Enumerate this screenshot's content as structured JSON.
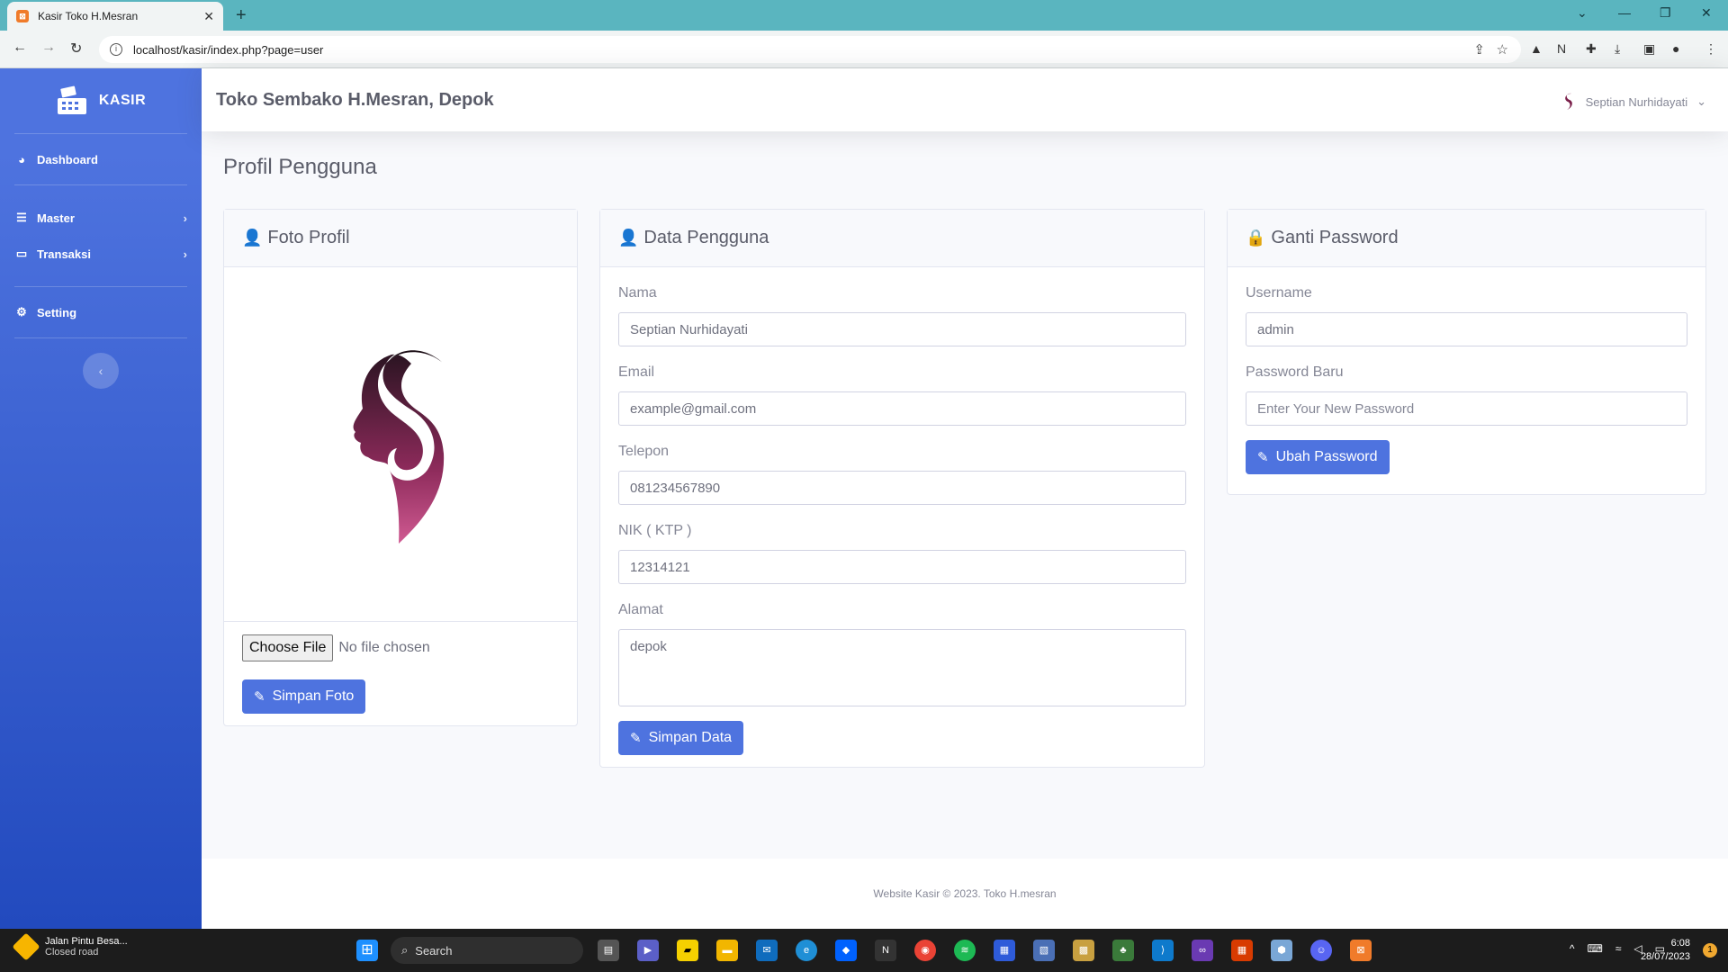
{
  "browser": {
    "tab_title": "Kasir Toko H.Mesran",
    "url": "localhost/kasir/index.php?page=user"
  },
  "sidebar": {
    "brand": "KASIR",
    "items": [
      {
        "label": "Dashboard",
        "icon": "dashboard-icon"
      },
      {
        "label": "Master",
        "icon": "database-icon"
      },
      {
        "label": "Transaksi",
        "icon": "desktop-icon"
      },
      {
        "label": "Setting",
        "icon": "cogs-icon"
      }
    ]
  },
  "topbar": {
    "store_name": "Toko Sembako H.Mesran, Depok",
    "user_name": "Septian Nurhidayati"
  },
  "page": {
    "title": "Profil Pengguna"
  },
  "foto_profil": {
    "header": "Foto Profil",
    "file_button": "Choose File",
    "file_status": "No file chosen",
    "save_button": "Simpan Foto"
  },
  "data_pengguna": {
    "header": "Data Pengguna",
    "fields": [
      {
        "label": "Nama",
        "value": "Septian Nurhidayati"
      },
      {
        "label": "Email",
        "value": "example@gmail.com"
      },
      {
        "label": "Telepon",
        "value": "081234567890"
      },
      {
        "label": "NIK ( KTP )",
        "value": "12314121"
      },
      {
        "label": "Alamat",
        "value": "depok"
      }
    ],
    "save_button": "Simpan Data"
  },
  "ganti_password": {
    "header": "Ganti Password",
    "username_label": "Username",
    "username_value": "admin",
    "password_label": "Password Baru",
    "password_placeholder": "Enter Your New Password",
    "button": "Ubah Password"
  },
  "footer": {
    "text": "Website Kasir © 2023. Toko H.mesran"
  },
  "taskbar": {
    "weather_title": "Jalan Pintu Besa...",
    "weather_sub": "Closed road",
    "search": "Search",
    "time": "6:08",
    "date": "28/07/2023",
    "notifications": "1"
  },
  "colors": {
    "primary": "#4e73df",
    "sidebar_end": "#224abe"
  }
}
